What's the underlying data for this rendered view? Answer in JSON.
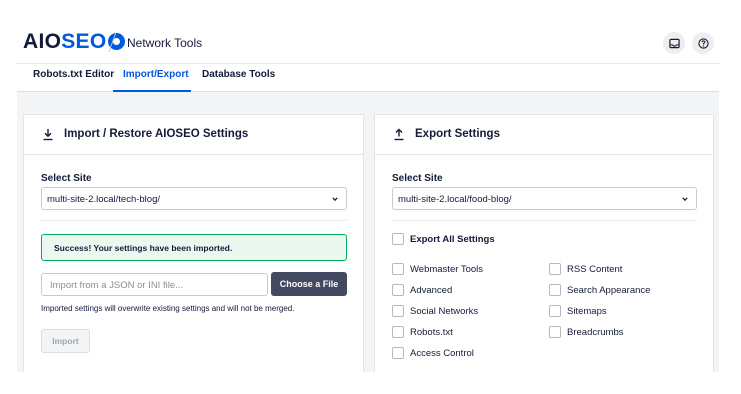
{
  "header": {
    "logo_prefix": "AIO",
    "logo_suffix": "SEO",
    "page_title": "Network Tools"
  },
  "tabs": [
    {
      "label": "Robots.txt Editor"
    },
    {
      "label": "Import/Export"
    },
    {
      "label": "Database Tools"
    }
  ],
  "active_tab": "Import/Export",
  "import_card": {
    "title": "Import / Restore AIOSEO Settings",
    "select_label": "Select Site",
    "select_value": "multi-site-2.local/tech-blog/",
    "success_message": "Success! Your settings have been imported.",
    "file_placeholder": "Import from a JSON or INI file...",
    "choose_button": "Choose a File",
    "note": "Imported settings will overwrite existing settings and will not be merged.",
    "import_button": "Import"
  },
  "export_card": {
    "title": "Export Settings",
    "select_label": "Select Site",
    "select_value": "multi-site-2.local/food-blog/",
    "export_all_label": "Export All Settings",
    "options_left": [
      "Webmaster Tools",
      "Advanced",
      "Social Networks",
      "Robots.txt",
      "Access Control"
    ],
    "options_right": [
      "RSS Content",
      "Search Appearance",
      "Sitemaps",
      "Breadcrumbs"
    ]
  },
  "colors": {
    "brand_blue": "#005ae0",
    "success_green": "#00aa63",
    "dark_button": "#434960"
  }
}
